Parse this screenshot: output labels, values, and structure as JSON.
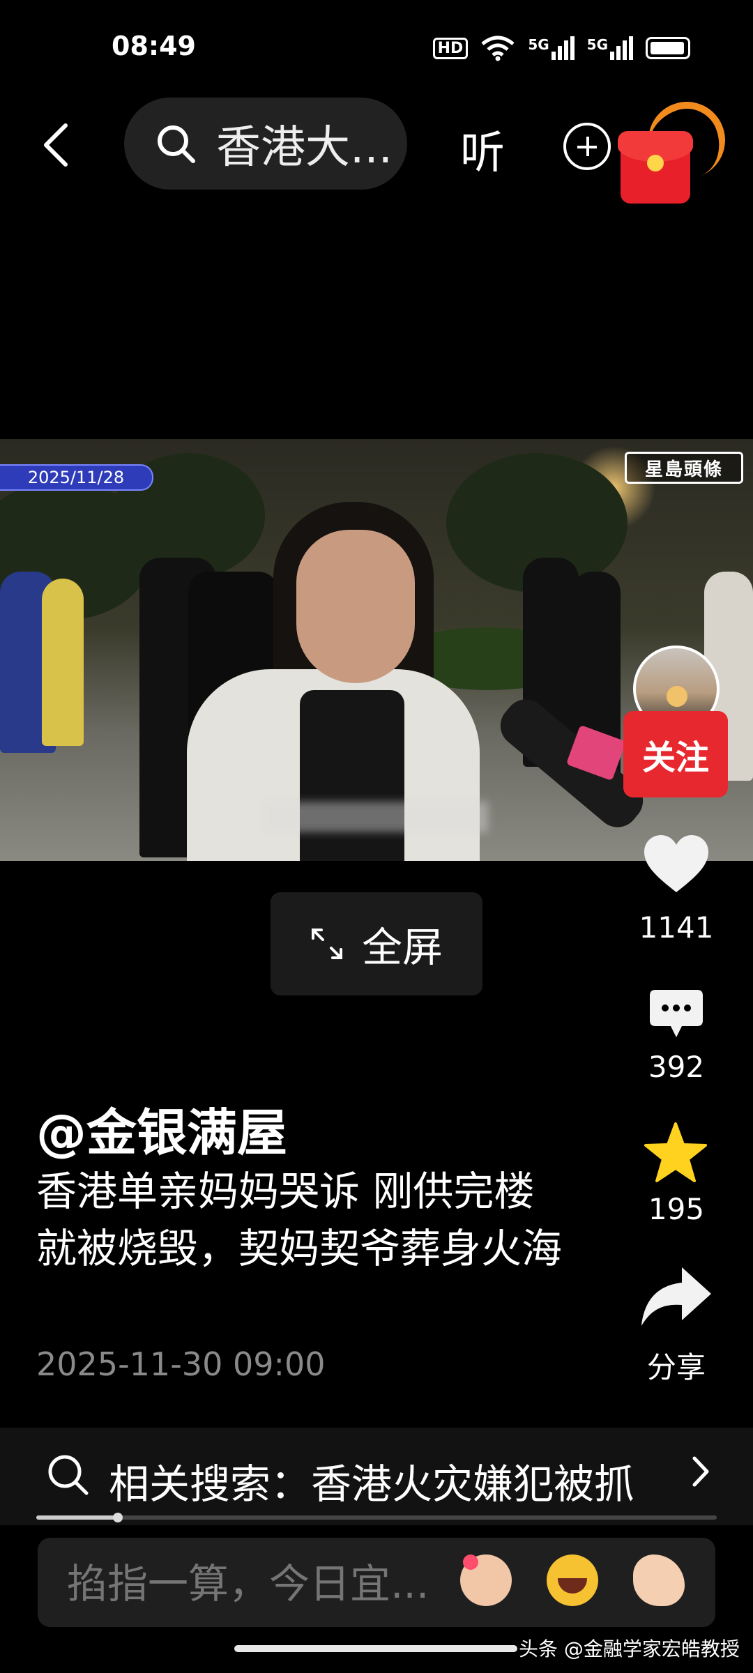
{
  "status_bar": {
    "time": "08:49",
    "icons": [
      "hd-icon",
      "wifi-icon",
      "5g-signal-icon",
      "5g-signal-icon",
      "battery-icon"
    ],
    "hd_label": "HD",
    "network_1": "5G",
    "network_2": "5G"
  },
  "nav": {
    "search_text": "香港大...",
    "listen_label": "听"
  },
  "video": {
    "date_badge": "2025/11/28",
    "watermark": "星島頭條"
  },
  "rail": {
    "follow_label": "关注",
    "like_count": "1141",
    "comment_count": "392",
    "favorite_count": "195",
    "share_label": "分享"
  },
  "fullscreen_label": "全屏",
  "post": {
    "author": "@金银满屋",
    "title": "香港单亲妈妈哭诉 刚供完楼就被烧毁，契妈契爷葬身火海",
    "datetime": "2025-11-30 09:00"
  },
  "related_search": {
    "text": "相关搜索：香港火灾嫌犯被抓",
    "progress": 0.12
  },
  "comment": {
    "placeholder": "掐指一算，今日宜..."
  },
  "credit": "头条 @金融学家宏皓教授",
  "colors": {
    "background": "#000000",
    "follow_red": "#e8282f",
    "star_yellow": "#ffd21f",
    "date_badge_blue": "#2f3cba"
  }
}
